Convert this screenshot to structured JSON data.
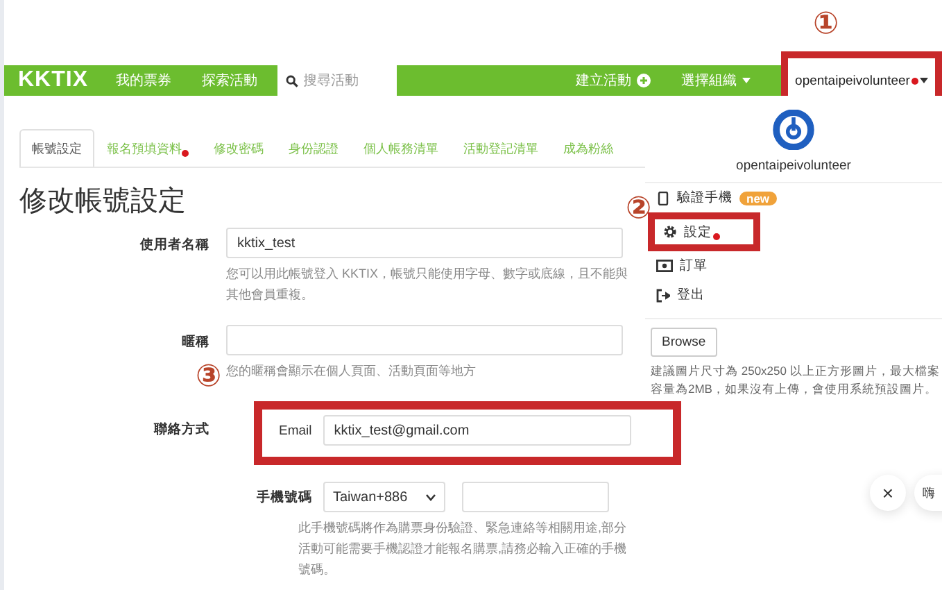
{
  "nav": {
    "logo": "KKTIX",
    "links": [
      "我的票券",
      "探索活動"
    ],
    "search": {
      "placeholder": "搜尋活動"
    },
    "create": "建立活動",
    "org": "選擇組織",
    "user": {
      "name": "opentaipeivolunteer",
      "dot": true,
      "highlighted": true,
      "marker": "①"
    }
  },
  "tabs": [
    {
      "label": "帳號設定",
      "selected": true,
      "dot": false
    },
    {
      "label": "報名預填資料",
      "selected": false,
      "dot": true
    },
    {
      "label": "修改密碼",
      "selected": false,
      "dot": false
    },
    {
      "label": "身份認證",
      "selected": false,
      "dot": false
    },
    {
      "label": "個人帳務清單",
      "selected": false,
      "dot": false
    },
    {
      "label": "活動登記清單",
      "selected": false,
      "dot": false
    },
    {
      "label": "成為粉絲",
      "selected": false,
      "dot": false
    }
  ],
  "title": "修改帳號設定",
  "form": {
    "username": {
      "label": "使用者名稱",
      "value": "kktix_test",
      "hint": "您可以用此帳號登入 KKTIX，帳號只能使用字母、數字或底線，且不能與其他會員重複。"
    },
    "nickname": {
      "label": "暱稱",
      "hint": "您的暱稱會顯示在個人頁面、活動頁面等地方",
      "marker": "③"
    },
    "contact": {
      "label": "聯絡方式",
      "email_label": "Email",
      "email": "kktix_test@gmail.com",
      "highlighted": true
    },
    "phone": {
      "label": "手機號碼",
      "country": "Taiwan+886",
      "hint": "此手機號碼將作為購票身份驗證、緊急連絡等相關用途,部分活動可能需要手機認證才能報名購票,請務必輸入正確的手機號碼。"
    }
  },
  "menu": {
    "name": "opentaipeivolunteer",
    "marker": "②",
    "items": [
      {
        "kind": "phone",
        "label": "驗證手機",
        "badge": "new",
        "dot": false,
        "highlighted": false
      },
      {
        "kind": "settings",
        "label": "設定",
        "dot": true,
        "highlighted": true
      },
      {
        "kind": "orders",
        "label": "訂單",
        "dot": false,
        "highlighted": false
      },
      {
        "kind": "logout",
        "label": "登出",
        "dot": false,
        "highlighted": false
      }
    ],
    "browse": "Browse",
    "hint": "建議圖片尺寸為 250x250 以上正方形圖片，最大檔案容量為2MB，如果沒有上傳，會使用系統預設圖片。"
  },
  "chat": {
    "close": "×",
    "greeting": "嗨"
  }
}
